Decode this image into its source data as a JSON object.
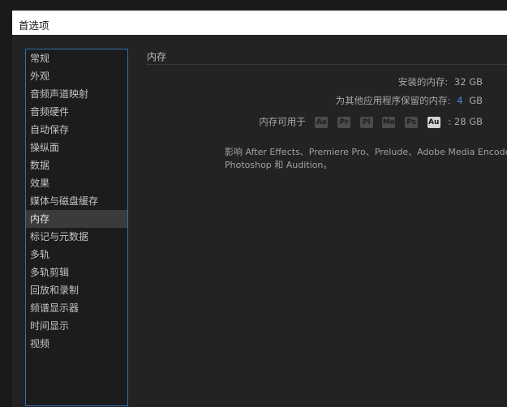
{
  "window": {
    "title": "首选项"
  },
  "sidebar": {
    "items": [
      {
        "label": "常规"
      },
      {
        "label": "外观"
      },
      {
        "label": "音频声道映射"
      },
      {
        "label": "音频硬件"
      },
      {
        "label": "自动保存"
      },
      {
        "label": "操纵面"
      },
      {
        "label": "数据"
      },
      {
        "label": "效果"
      },
      {
        "label": "媒体与磁盘缓存"
      },
      {
        "label": "内存"
      },
      {
        "label": "标记与元数据"
      },
      {
        "label": "多轨"
      },
      {
        "label": "多轨剪辑"
      },
      {
        "label": "回放和录制"
      },
      {
        "label": "频谱显示器"
      },
      {
        "label": "时间显示"
      },
      {
        "label": "视频"
      }
    ],
    "selected": "内存"
  },
  "memory": {
    "section_title": "内存",
    "installed_label": "安装的内存:",
    "installed_value": "32 GB",
    "reserved_label": "为其他应用程序保留的内存:",
    "reserved_value": "4",
    "reserved_unit": "GB",
    "available_label": "内存可用于",
    "apps": [
      {
        "name": "Ae",
        "active": false
      },
      {
        "name": "Pr",
        "active": false
      },
      {
        "name": "Pl",
        "active": false
      },
      {
        "name": "Me",
        "active": false
      },
      {
        "name": "Ps",
        "active": false
      },
      {
        "name": "Au",
        "active": true
      }
    ],
    "available_value": ": 28 GB",
    "description_line1": "影响 After Effects、Premiere Pro、Prelude、Adobe Media Encoder、",
    "description_line2": "Photoshop 和 Audition。"
  }
}
